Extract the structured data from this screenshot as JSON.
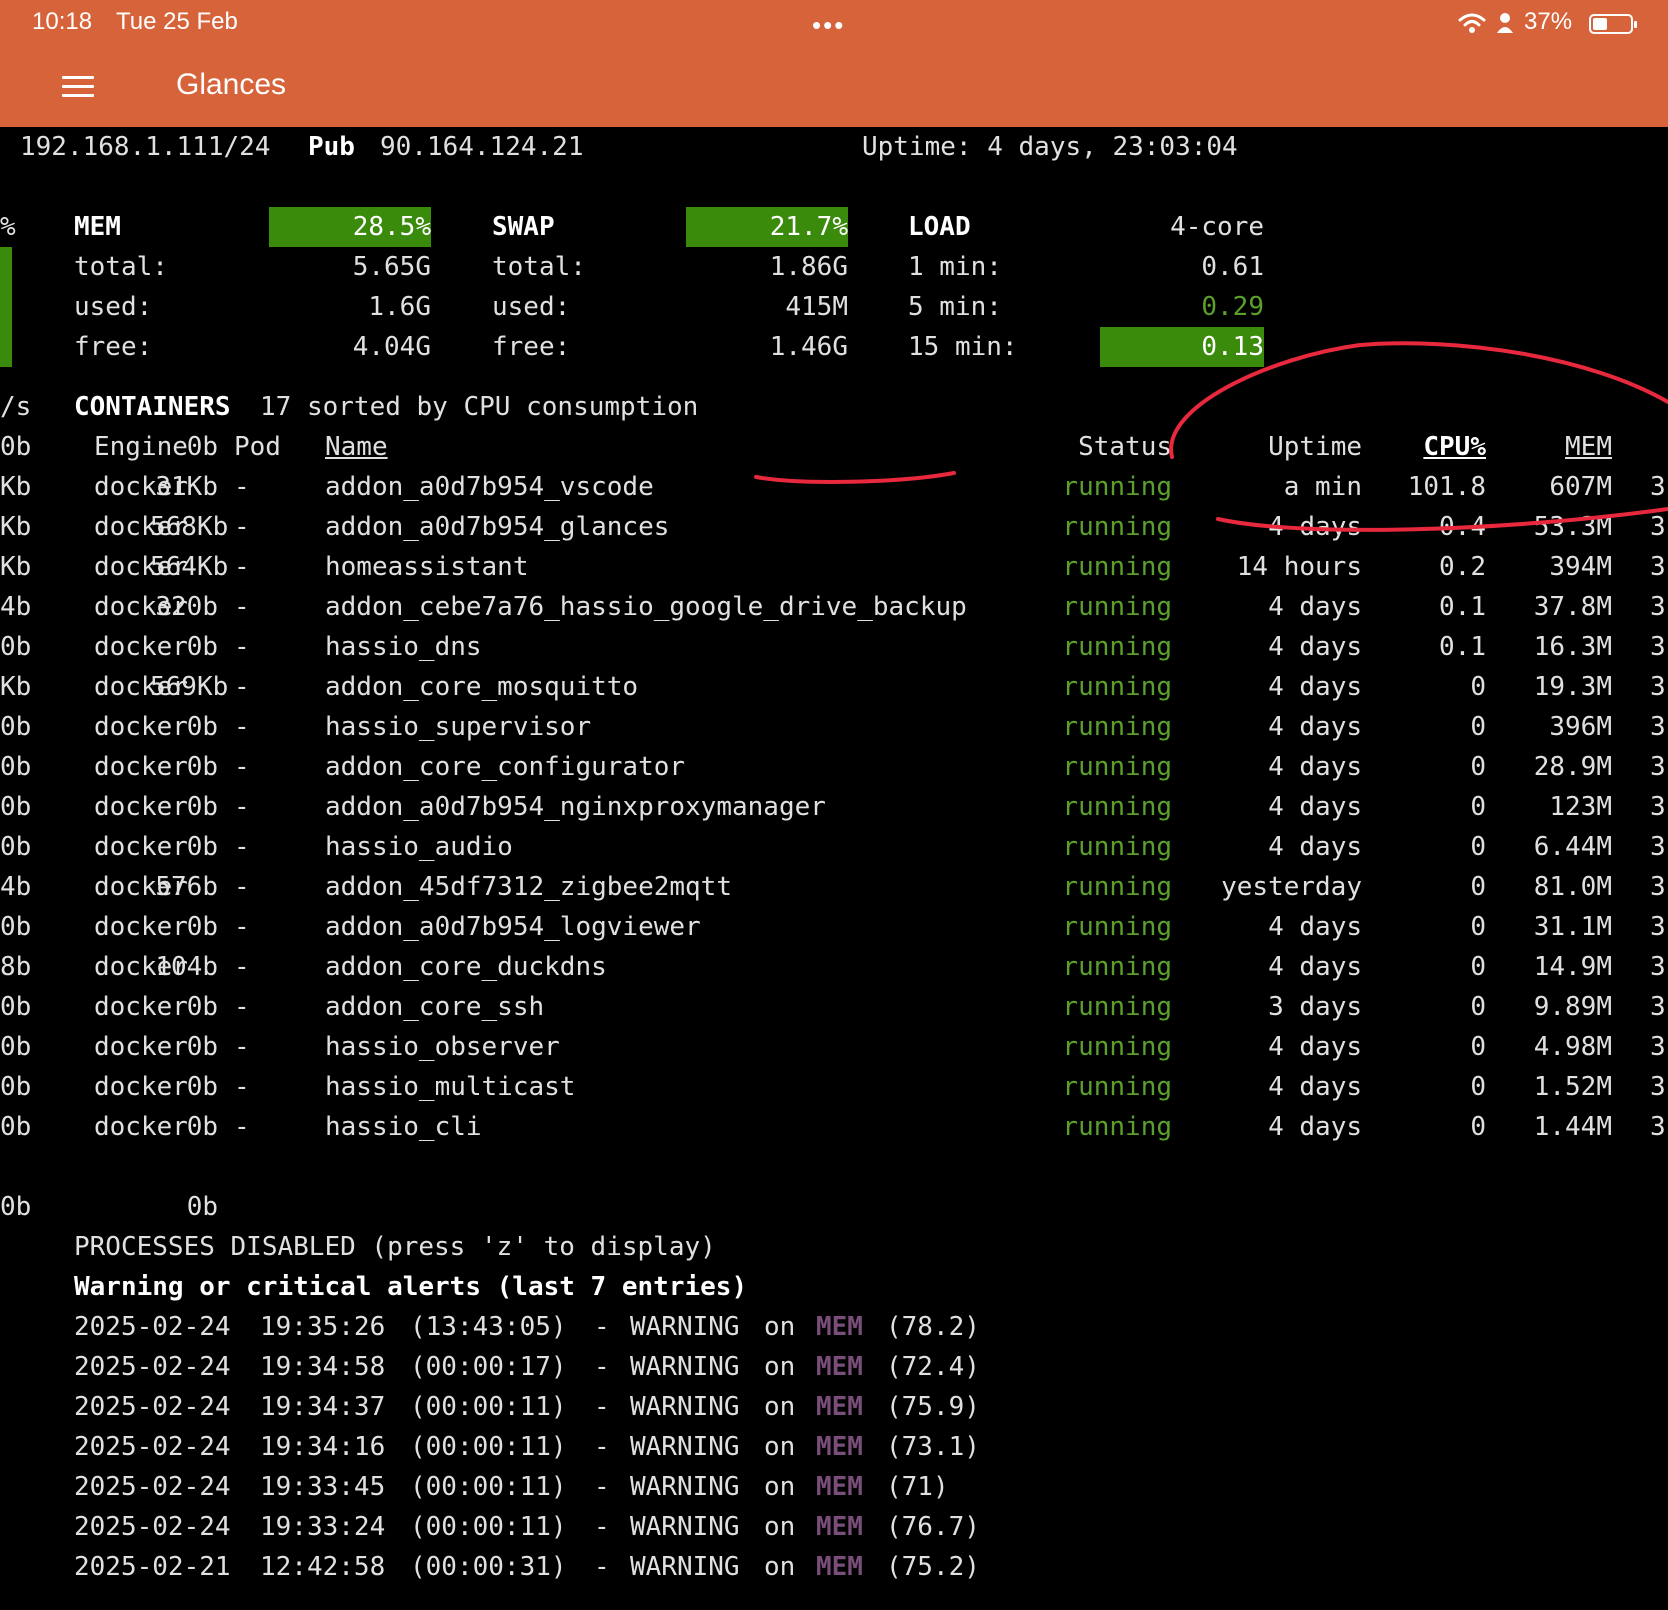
{
  "status_bar": {
    "time": "10:18",
    "date": "Tue 25 Feb",
    "dots": "•••",
    "battery": "37%"
  },
  "app": {
    "title": "Glances"
  },
  "network": {
    "ip": "192.168.1.111/24",
    "pub_label": "Pub",
    "pub_ip": "90.164.124.21",
    "uptime": "Uptime: 4 days, 23:03:04"
  },
  "mem": {
    "label": "MEM",
    "percent": "28.5%",
    "total_label": "total:",
    "total": "5.65G",
    "used_label": "used:",
    "used": "1.6G",
    "free_label": "free:",
    "free": "4.04G"
  },
  "swap": {
    "label": "SWAP",
    "percent": "21.7%",
    "total_label": "total:",
    "total": "1.86G",
    "used_label": "used:",
    "used": "415M",
    "free_label": "free:",
    "free": "1.46G"
  },
  "load": {
    "label": "LOAD",
    "cores": "4-core",
    "min1_label": "1 min:",
    "min1": "0.61",
    "min5_label": "5 min:",
    "min5": "0.29",
    "min15_label": "15 min:",
    "min15": "0.13"
  },
  "left_edge": {
    "pct": "%",
    "rate": "/s"
  },
  "containers": {
    "title": "CONTAINERS",
    "summary": "17 sorted by CPU consumption",
    "headers": {
      "engine": "Engine",
      "pod": "Pod",
      "name": "Name",
      "status": "Status",
      "uptime": "Uptime",
      "cpu": "CPU%",
      "mem": "MEM",
      "rx": "0b",
      "tx": "0b",
      "edge": "0b"
    },
    "rows": [
      {
        "edge": "Kb",
        "engine": "docker",
        "io": "31Kb",
        "pod": "-",
        "name": "addon_a0d7b954_vscode",
        "status": "running",
        "uptime": "a min",
        "cpu": "101.8",
        "mem": "607M",
        "tail": "3"
      },
      {
        "edge": "Kb",
        "engine": "docker",
        "io": "568Kb",
        "pod": "-",
        "name": "addon_a0d7b954_glances",
        "status": "running",
        "uptime": "4 days",
        "cpu": "0.4",
        "mem": "53.3M",
        "tail": "3"
      },
      {
        "edge": "Kb",
        "engine": "docker",
        "io": "564Kb",
        "pod": "-",
        "name": "homeassistant",
        "status": "running",
        "uptime": "14 hours",
        "cpu": "0.2",
        "mem": "394M",
        "tail": "3"
      },
      {
        "edge": "4b",
        "engine": "docker",
        "io": "320b",
        "pod": "-",
        "name": "addon_cebe7a76_hassio_google_drive_backup",
        "status": "running",
        "uptime": "4 days",
        "cpu": "0.1",
        "mem": "37.8M",
        "tail": "3"
      },
      {
        "edge": "0b",
        "engine": "docker",
        "io": "0b",
        "pod": "-",
        "name": "hassio_dns",
        "status": "running",
        "uptime": "4 days",
        "cpu": "0.1",
        "mem": "16.3M",
        "tail": "3"
      },
      {
        "edge": "Kb",
        "engine": "docker",
        "io": "569Kb",
        "pod": "-",
        "name": "addon_core_mosquitto",
        "status": "running",
        "uptime": "4 days",
        "cpu": "0",
        "mem": "19.3M",
        "tail": "3"
      },
      {
        "edge": "0b",
        "engine": "docker",
        "io": "0b",
        "pod": "-",
        "name": "hassio_supervisor",
        "status": "running",
        "uptime": "4 days",
        "cpu": "0",
        "mem": "396M",
        "tail": "3"
      },
      {
        "edge": "0b",
        "engine": "docker",
        "io": "0b",
        "pod": "-",
        "name": "addon_core_configurator",
        "status": "running",
        "uptime": "4 days",
        "cpu": "0",
        "mem": "28.9M",
        "tail": "3"
      },
      {
        "edge": "0b",
        "engine": "docker",
        "io": "0b",
        "pod": "-",
        "name": "addon_a0d7b954_nginxproxymanager",
        "status": "running",
        "uptime": "4 days",
        "cpu": "0",
        "mem": "123M",
        "tail": "3"
      },
      {
        "edge": "0b",
        "engine": "docker",
        "io": "0b",
        "pod": "-",
        "name": "hassio_audio",
        "status": "running",
        "uptime": "4 days",
        "cpu": "0",
        "mem": "6.44M",
        "tail": "3"
      },
      {
        "edge": "4b",
        "engine": "docker",
        "io": "576b",
        "pod": "-",
        "name": "addon_45df7312_zigbee2mqtt",
        "status": "running",
        "uptime": "yesterday",
        "cpu": "0",
        "mem": "81.0M",
        "tail": "3"
      },
      {
        "edge": "0b",
        "engine": "docker",
        "io": "0b",
        "pod": "-",
        "name": "addon_a0d7b954_logviewer",
        "status": "running",
        "uptime": "4 days",
        "cpu": "0",
        "mem": "31.1M",
        "tail": "3"
      },
      {
        "edge": "8b",
        "engine": "docker",
        "io": "104b",
        "pod": "-",
        "name": "addon_core_duckdns",
        "status": "running",
        "uptime": "4 days",
        "cpu": "0",
        "mem": "14.9M",
        "tail": "3"
      },
      {
        "edge": "0b",
        "engine": "docker",
        "io": "0b",
        "pod": "-",
        "name": "addon_core_ssh",
        "status": "running",
        "uptime": "3 days",
        "cpu": "0",
        "mem": "9.89M",
        "tail": "3"
      },
      {
        "edge": "0b",
        "engine": "docker",
        "io": "0b",
        "pod": "-",
        "name": "hassio_observer",
        "status": "running",
        "uptime": "4 days",
        "cpu": "0",
        "mem": "4.98M",
        "tail": "3"
      },
      {
        "edge": "0b",
        "engine": "docker",
        "io": "0b",
        "pod": "-",
        "name": "hassio_multicast",
        "status": "running",
        "uptime": "4 days",
        "cpu": "0",
        "mem": "1.52M",
        "tail": "3"
      },
      {
        "edge": "0b",
        "engine": "docker",
        "io": "0b",
        "pod": "-",
        "name": "hassio_cli",
        "status": "running",
        "uptime": "4 days",
        "cpu": "0",
        "mem": "1.44M",
        "tail": "3"
      }
    ],
    "footer": {
      "edge": "0b",
      "io": "0b"
    }
  },
  "processes_disabled": "PROCESSES DISABLED (press 'z' to display)",
  "alerts": {
    "title": "Warning or critical alerts (last 7 entries)",
    "entries": [
      {
        "date": "2025-02-24",
        "time": "19:35:26",
        "duration": "(13:43:05)",
        "sep": "-",
        "level": "WARNING",
        "on": "on",
        "sensor": "MEM",
        "value": "(78.2)"
      },
      {
        "date": "2025-02-24",
        "time": "19:34:58",
        "duration": "(00:00:17)",
        "sep": "-",
        "level": "WARNING",
        "on": "on",
        "sensor": "MEM",
        "value": "(72.4)"
      },
      {
        "date": "2025-02-24",
        "time": "19:34:37",
        "duration": "(00:00:11)",
        "sep": "-",
        "level": "WARNING",
        "on": "on",
        "sensor": "MEM",
        "value": "(75.9)"
      },
      {
        "date": "2025-02-24",
        "time": "19:34:16",
        "duration": "(00:00:11)",
        "sep": "-",
        "level": "WARNING",
        "on": "on",
        "sensor": "MEM",
        "value": "(73.1)"
      },
      {
        "date": "2025-02-24",
        "time": "19:33:45",
        "duration": "(00:00:11)",
        "sep": "-",
        "level": "WARNING",
        "on": "on",
        "sensor": "MEM",
        "value": "(71)"
      },
      {
        "date": "2025-02-24",
        "time": "19:33:24",
        "duration": "(00:00:11)",
        "sep": "-",
        "level": "WARNING",
        "on": "on",
        "sensor": "MEM",
        "value": "(76.7)"
      },
      {
        "date": "2025-02-21",
        "time": "12:42:58",
        "duration": "(00:00:31)",
        "sep": "-",
        "level": "WARNING",
        "on": "on",
        "sensor": "MEM",
        "value": "(75.2)"
      }
    ]
  },
  "colors": {
    "header_bg": "#d6633a",
    "terminal_bg": "#000000",
    "bar_green": "#3a8a0c",
    "running_green": "#5aa02a",
    "mem_purple": "#7a4d7a",
    "annotation_red": "#e8283c"
  },
  "icons": {
    "menu": "hamburger-menu-icon",
    "wifi": "wifi-icon",
    "person": "person-icon",
    "battery": "battery-icon"
  },
  "levels": {
    "mem_bar": 0.285,
    "swap_bar": 0.217,
    "battery": 0.37
  }
}
